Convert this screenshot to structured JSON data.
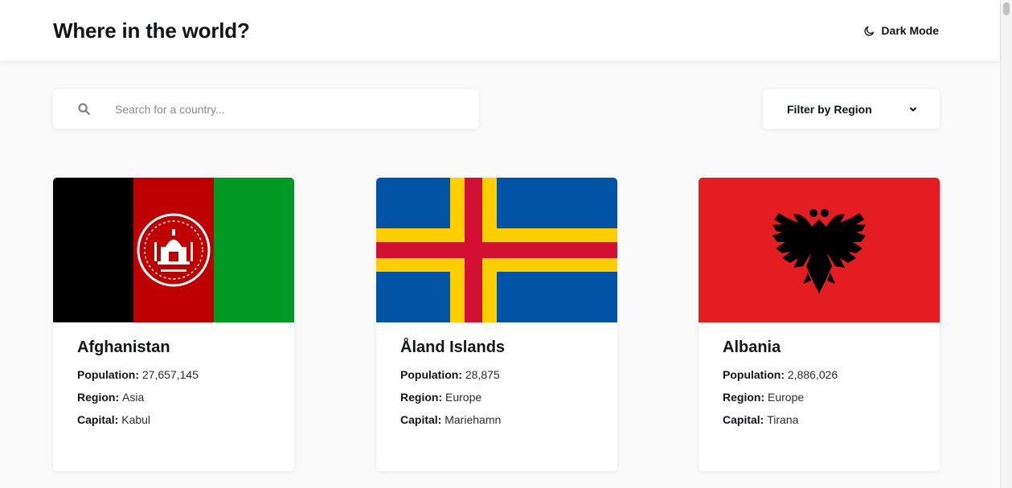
{
  "header": {
    "title": "Where in the world?",
    "mode_label": "Dark Mode"
  },
  "search": {
    "placeholder": "Search for a country...",
    "value": ""
  },
  "filter": {
    "label": "Filter by Region"
  },
  "labels": {
    "population": "Population:",
    "region": "Region:",
    "capital": "Capital:"
  },
  "countries": [
    {
      "name": "Afghanistan",
      "population": "27,657,145",
      "region": "Asia",
      "capital": "Kabul"
    },
    {
      "name": "Åland Islands",
      "population": "28,875",
      "region": "Europe",
      "capital": "Mariehamn"
    },
    {
      "name": "Albania",
      "population": "2,886,026",
      "region": "Europe",
      "capital": "Tirana"
    }
  ],
  "icons": {
    "search": "search-icon",
    "mode": "moon-icon",
    "dropdown": "chevron-down-icon"
  },
  "colors": {
    "background": "#fafafa",
    "surface": "#ffffff",
    "text": "#111517"
  }
}
